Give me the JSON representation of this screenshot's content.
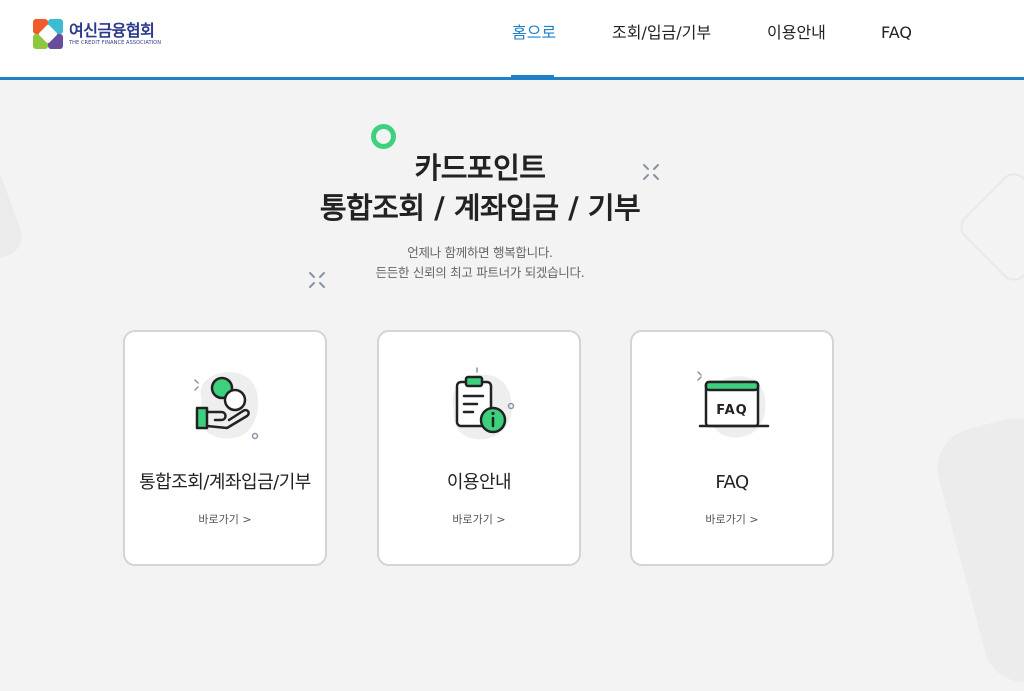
{
  "header": {
    "logo": {
      "name": "여신금융협회",
      "sub": "THE CREDIT FINANCE ASSOCIATION"
    },
    "nav": [
      {
        "label": "홈으로",
        "active": true
      },
      {
        "label": "조회/입금/기부",
        "active": false
      },
      {
        "label": "이용안내",
        "active": false
      },
      {
        "label": "FAQ",
        "active": false
      }
    ]
  },
  "hero": {
    "title_line1": "카드포인트",
    "title_line2": "통합조회 / 계좌입금 / 기부",
    "desc_line1": "언제나 함께하면 행복합니다.",
    "desc_line2": "든든한 신뢰의 최고 파트너가 되겠습니다."
  },
  "cards": [
    {
      "title": "통합조회/계좌입금/기부",
      "link": "바로가기 >",
      "icon": "hand-coin-icon"
    },
    {
      "title": "이용안내",
      "link": "바로가기 >",
      "icon": "clipboard-info-icon"
    },
    {
      "title": "FAQ",
      "link": "바로가기 >",
      "icon": "faq-board-icon",
      "icon_text": "FAQ"
    }
  ],
  "colors": {
    "accent": "#1f7fc8",
    "green": "#3dd17e",
    "brand_navy": "#2b3a8c"
  }
}
